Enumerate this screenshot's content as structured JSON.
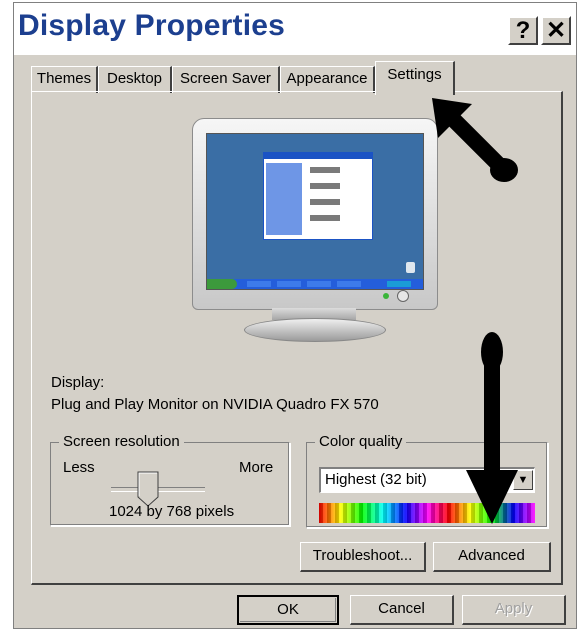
{
  "window": {
    "title": "Display Properties",
    "help_label": "?",
    "close_label": "✕"
  },
  "tabs": [
    {
      "label": "Themes"
    },
    {
      "label": "Desktop"
    },
    {
      "label": "Screen Saver"
    },
    {
      "label": "Appearance"
    },
    {
      "label": "Settings",
      "active": true
    }
  ],
  "display": {
    "label": "Display:",
    "device": "Plug and Play Monitor on NVIDIA Quadro FX 570"
  },
  "resolution": {
    "legend": "Screen resolution",
    "less": "Less",
    "more": "More",
    "value": "1024 by 768 pixels"
  },
  "color_quality": {
    "legend": "Color quality",
    "selected": "Highest (32 bit)"
  },
  "buttons": {
    "troubleshoot": "Troubleshoot...",
    "advanced": "Advanced",
    "ok": "OK",
    "cancel": "Cancel",
    "apply": "Apply"
  },
  "colors": {
    "title_text": "#1c3f8f",
    "dialog_bg": "#d4d0c8",
    "desktop_bg": "#3a6ea5"
  },
  "icons": {
    "help": "question-mark-icon",
    "close": "close-icon",
    "dropdown": "chevron-down-icon"
  }
}
